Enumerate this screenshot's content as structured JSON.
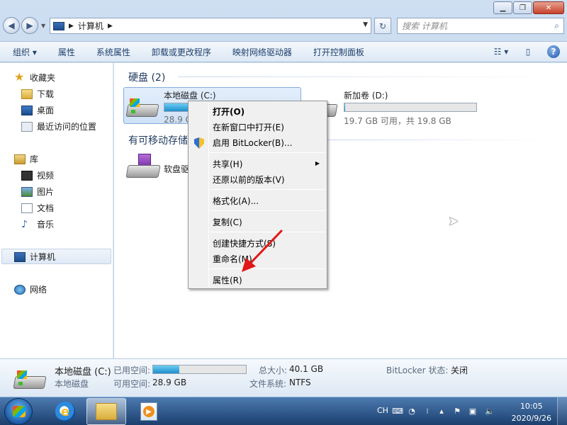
{
  "window": {
    "caption_buttons": [
      "minimize",
      "maximize",
      "close"
    ]
  },
  "address": {
    "path": "计算机",
    "search_placeholder": "搜索 计算机"
  },
  "toolbar": {
    "organize": "组织",
    "properties": "属性",
    "system_properties": "系统属性",
    "uninstall": "卸载或更改程序",
    "map_drive": "映射网络驱动器",
    "control_panel": "打开控制面板"
  },
  "sidebar": {
    "favorites": "收藏夹",
    "downloads": "下载",
    "desktop": "桌面",
    "recent": "最近访问的位置",
    "libraries": "库",
    "videos": "视频",
    "pictures": "图片",
    "documents": "文档",
    "music": "音乐",
    "computer": "计算机",
    "network": "网络"
  },
  "content": {
    "hard_disks_header": "硬盘 (2)",
    "removable_header": "有可移动存储",
    "drive_c": {
      "name": "本地磁盘 (C:)",
      "free_text": "28.9 G",
      "used_fraction": 0.28
    },
    "drive_d": {
      "name": "新加卷 (D:)",
      "free_text": "19.7 GB 可用，共 19.8 GB",
      "used_fraction": 0.005
    },
    "floppy": {
      "name": "软盘驱"
    }
  },
  "context_menu": {
    "open": "打开(O)",
    "open_new_window": "在新窗口中打开(E)",
    "bitlocker": "启用 BitLocker(B)...",
    "share": "共享(H)",
    "restore": "还原以前的版本(V)",
    "format": "格式化(A)...",
    "copy": "复制(C)",
    "shortcut": "创建快捷方式(S)",
    "rename": "重命名(M)",
    "properties": "属性(R)"
  },
  "details": {
    "name": "本地磁盘 (C:)",
    "type": "本地磁盘",
    "used_label": "已用空间:",
    "free_label": "可用空间:",
    "free_value": "28.9 GB",
    "used_fraction": 0.28,
    "total_label": "总大小:",
    "total_value": "40.1 GB",
    "fs_label": "文件系统:",
    "fs_value": "NTFS",
    "bitlocker_label": "BitLocker 状态:",
    "bitlocker_value": "关闭"
  },
  "taskbar": {
    "language": "CH",
    "time": "10:05",
    "date": "2020/9/26"
  },
  "colors": {
    "accent": "#1f8fcf",
    "annotation_arrow": "#e01818"
  }
}
